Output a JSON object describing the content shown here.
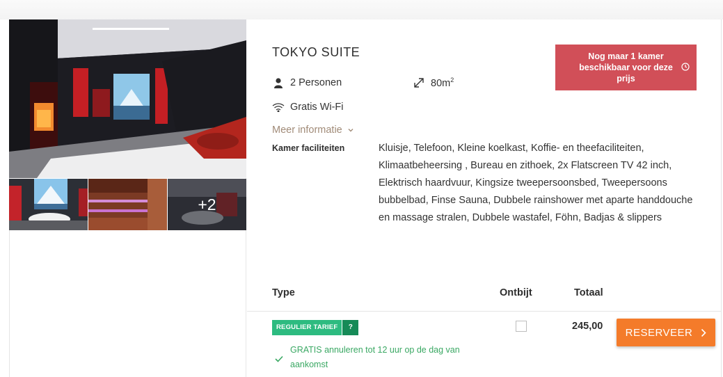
{
  "room": {
    "title": "TOKYO SUITE",
    "persons": "2 Personen",
    "size": "80m",
    "size_sup": "2",
    "wifi": "Gratis Wi-Fi",
    "more_info": "Meer informatie"
  },
  "gallery": {
    "more_count": "+2"
  },
  "availability_alert": "Nog maar 1 kamer beschikbaar voor deze prijs",
  "facilities": {
    "label": "Kamer faciliteiten",
    "text": "Kluisje, Telefoon, Kleine koelkast, Koffie- en theefaciliteiten, Klimaatbeheersing , Bureau en zithoek, 2x Flatscreen TV 42 inch, Elektrisch haardvuur, Kingsize tweepersoonsbed, Tweepersoons bubbelbad, Finse Sauna, Dubbele rainshower met aparte handdouche en massage stralen, Dubbele wastafel, Föhn, Badjas & slippers"
  },
  "table": {
    "headers": {
      "type": "Type",
      "breakfast": "Ontbijt",
      "total": "Totaal"
    },
    "rows": [
      {
        "rate_label": "REGULIER TARIEF",
        "rate_help": "?",
        "cancellation": "GRATIS annuleren tot 12 uur op de dag van aankomst",
        "breakfast_checked": false,
        "price": "245,00",
        "button": "RESERVEER"
      }
    ]
  },
  "colors": {
    "alert": "#d14f58",
    "rate_label": "#2dbb80",
    "rate_help": "#168a57",
    "cancellation": "#3aa863",
    "reserve_button": "#f47b2a",
    "more_info": "#a18b78"
  }
}
